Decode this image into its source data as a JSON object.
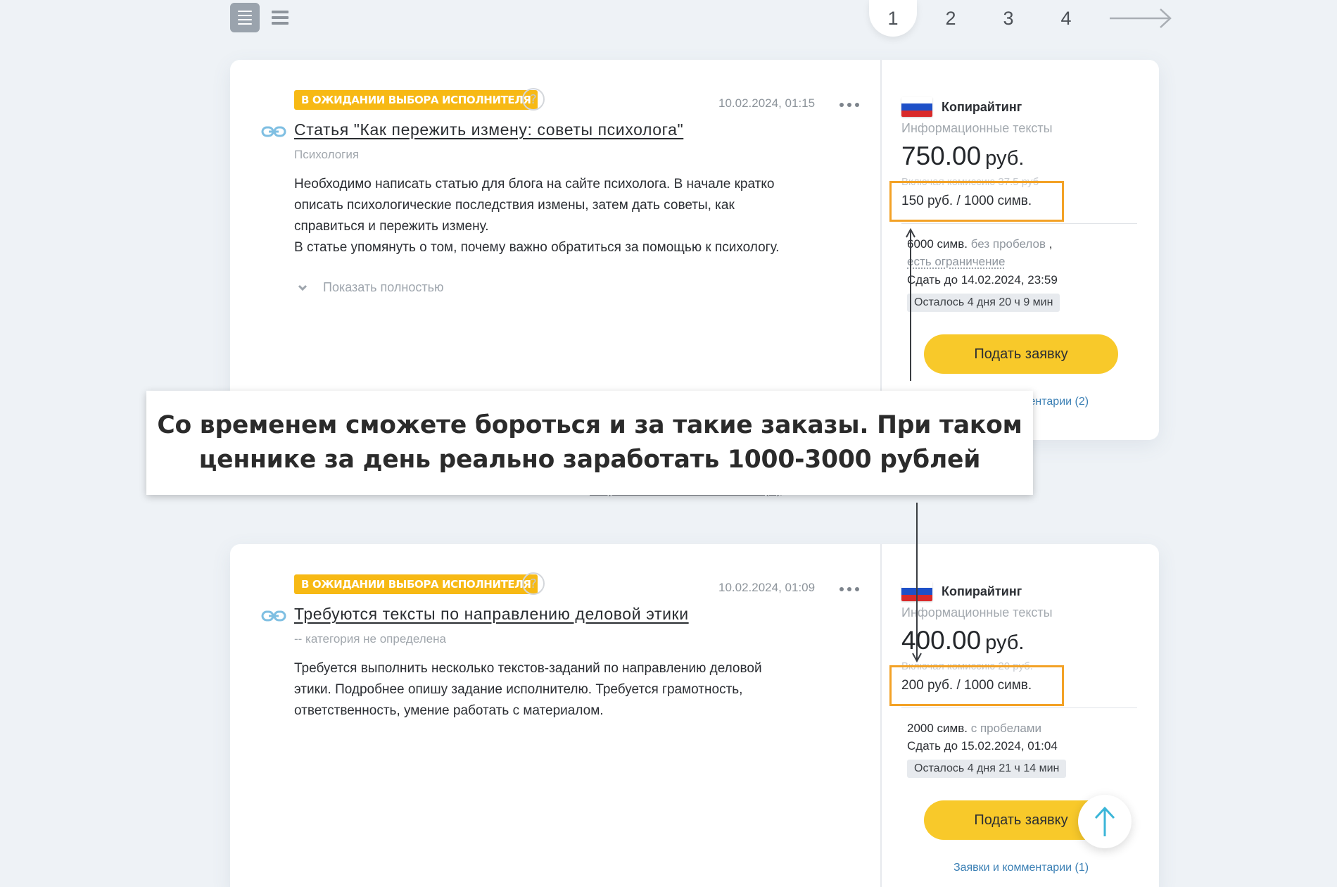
{
  "toolbar": {
    "view_list_icon": "list-view-icon",
    "view_compact_icon": "compact-view-icon"
  },
  "pagination": {
    "pages": [
      "1",
      "2",
      "3",
      "4"
    ],
    "current": "1",
    "next_icon": "arrow-right-icon"
  },
  "orders": [
    {
      "status": "В ОЖИДАНИИ ВЫБОРА ИСПОЛНИТЕЛЯ",
      "help": "?",
      "date": "10.02.2024, 01:15",
      "title": "Статья \"Как пережить измену: советы психолога\"",
      "category": "Психология",
      "description": [
        "Необходимо написать статью для блога на сайте психолога. В начале кратко\nописать психологические последствия измены, затем дать советы, как\nсправиться и пережить измену.",
        "В статье упомянуть о том, почему важно обратиться за помощью к психологу."
      ],
      "show_more": "Показать полностью",
      "service": "Копирайтинг",
      "subservice": "Информационные тексты",
      "price": "750.00",
      "currency": "руб.",
      "commission": "Включая комиссию 37.5 руб",
      "per_1000": "150 руб. / 1000 симв.",
      "volume": "6000 симв.",
      "spaces": "без пробелов",
      "volume_suffix": ",",
      "limit": "есть ограничение",
      "deadline": "Сдать до 14.02.2024, 23:59",
      "remaining": "Осталось 4 дня 20 ч 9 мин",
      "apply": "Подать заявку",
      "comments": "Заявки и комментарии (2)"
    },
    {
      "status": "В ОЖИДАНИИ ВЫБОРА ИСПОЛНИТЕЛЯ",
      "help": "?",
      "date": "10.02.2024, 01:09",
      "title": "Требуются тексты по направлению деловой этики",
      "category": "-- категория не определена",
      "description": [
        "Требуется выполнить несколько текстов-заданий по направлению деловой\nэтики. Подробнее опишу задание исполнителю. Требуется грамотность,\nответственность, умение работать с материалом."
      ],
      "service": "Копирайтинг",
      "subservice": "Информационные тексты",
      "price": "400.00",
      "currency": "руб.",
      "commission": "Включая комиссию 20 руб.",
      "per_1000": "200 руб. / 1000 симв.",
      "volume": "2000 симв.",
      "spaces": "с пробелами",
      "deadline": "Сдать до 15.02.2024, 01:04",
      "remaining": "Осталось 4 дня 21 ч 14 мин",
      "apply": "Подать заявку",
      "comments": "Заявки и комментарии (1)"
    }
  ],
  "more_orders_link": "Еще заказы пользователя (3)",
  "callout": "Со временем сможете бороться и за такие заказы. При таком ценнике за день реально заработать 1000-3000 рублей",
  "colors": {
    "status_badge": "#f7b914",
    "apply_button": "#f8c92a",
    "highlight_box": "#f3a226",
    "link_blue": "#3a7fb4",
    "flag": [
      "#ffffff",
      "#1e50c8",
      "#d92a2a"
    ]
  }
}
